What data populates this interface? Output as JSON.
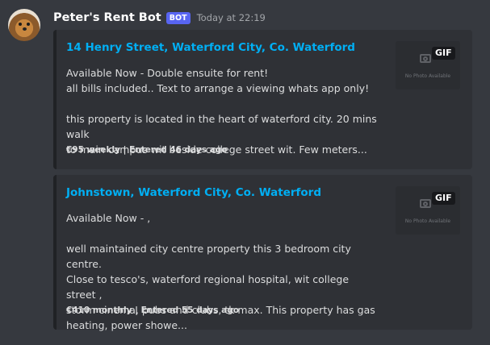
{
  "message": {
    "username": "Peter's Rent Bot",
    "bot_tag": "BOT",
    "timestamp": "Today at 22:19"
  },
  "embeds": [
    {
      "title": "14 Henry Street, Waterford City, Co. Waterford",
      "desc_lines": [
        "Available Now - Double ensuite for rent!",
        "all bills included.. Text to arrange a viewing whats app only!",
        "",
        "this property is located in the heart of waterford city. 20 mins walk",
        "to main campus wit beside college street wit. Few meters..."
      ],
      "footer": "€95 weekly | Entered 46 days ago",
      "thumb_badge": "GIF",
      "thumb_text": "No Photo Available"
    },
    {
      "title": "Johnstown, Waterford City, Co. Waterford",
      "desc_lines": [
        "Available Now - ,",
        "",
        "well maintained city centre property this 3 bedroom city centre.",
        "Close to tesco's, waterford regional hospital, wit college street ,",
        "storm cinema, pubs and clubs, tk max. This property has gas",
        "heating, power showe..."
      ],
      "footer": "€410 monthly | Entered 55 days ago",
      "thumb_badge": "GIF",
      "thumb_text": "No Photo Available"
    }
  ],
  "colors": {
    "background": "#36393f",
    "embed_bg": "#2f3136",
    "link": "#00aff4",
    "bot_tag": "#5865f2"
  }
}
